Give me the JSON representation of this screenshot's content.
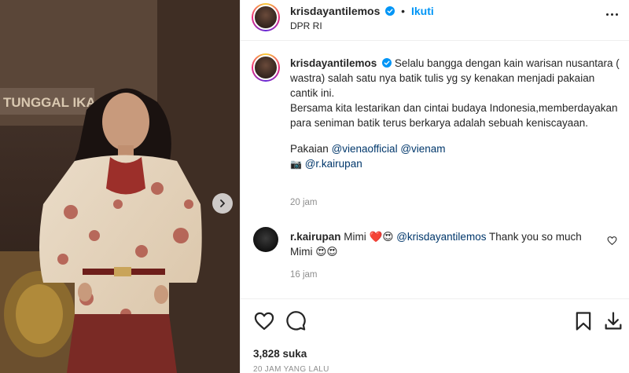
{
  "post": {
    "author": "krisdayantilemos",
    "follow_label": "Ikuti",
    "separator": "•",
    "location": "DPR RI",
    "caption": {
      "username": "krisdayantilemos",
      "line1": "Selalu bangga dengan kain warisan nusantara ( wastra) salah satu nya batik tulis yg sy kenakan menjadi pakaian cantik ini.",
      "line2": "Bersama kita lestarikan dan cintai budaya Indonesia,memberdayakan para seniman batik terus berkarya adalah sebuah keniscayaan.",
      "credits_prefix": "Pakaian",
      "mention1": "@vienaofficial",
      "mention2": "@vienam",
      "camera_icon": "📷",
      "mention3": "@r.kairupan",
      "time": "20 jam"
    },
    "comment": {
      "username": "r.kairupan",
      "text_before": "Mimi ",
      "emoji1": "❤️😍",
      "mention": "@krisdayantilemos",
      "text_after": " Thank you so much Mimi ",
      "emoji2": "😍😍",
      "time": "16 jam"
    },
    "media_background_text": "TUNGGAL IKA",
    "likes": "3,828 suka",
    "posted": "20 JAM YANG LALU"
  },
  "icons": {
    "more": "more-icon",
    "like": "heart-icon",
    "comment": "comment-icon",
    "save": "bookmark-icon",
    "download": "download-icon",
    "next": "chevron-right-icon"
  },
  "colors": {
    "link": "#0095f6",
    "mention": "#00376b",
    "muted": "#8e8e8e",
    "text": "#262626"
  }
}
